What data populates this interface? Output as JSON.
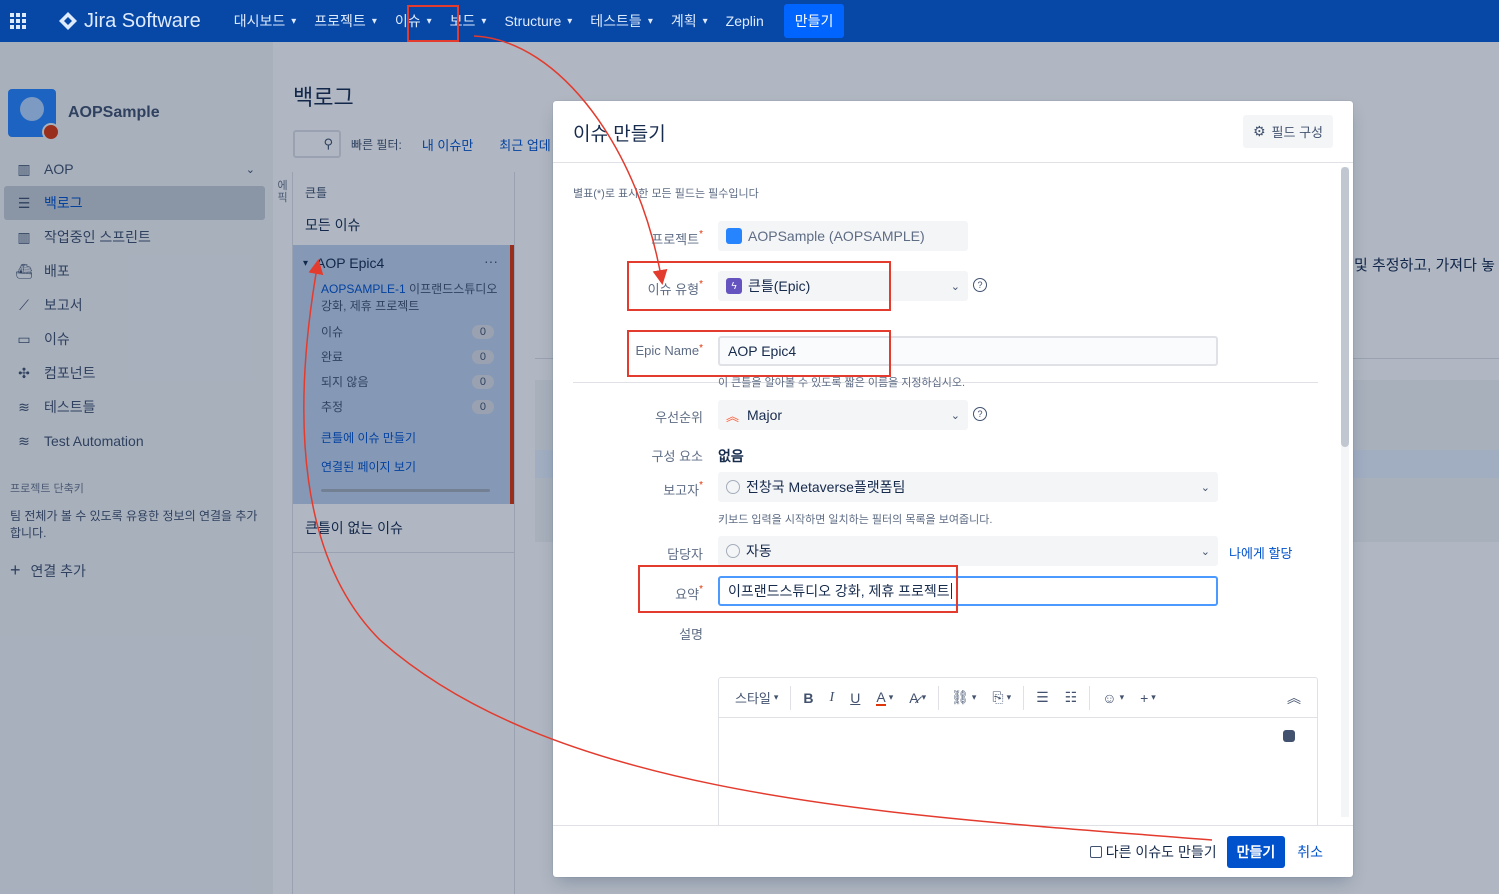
{
  "nav": {
    "product": "Jira Software",
    "items": [
      {
        "label": "대시보드",
        "chev": true
      },
      {
        "label": "프로젝트",
        "chev": true
      },
      {
        "label": "이슈",
        "chev": true
      },
      {
        "label": "보드",
        "chev": true
      },
      {
        "label": "Structure",
        "chev": true
      },
      {
        "label": "테스트들",
        "chev": true
      },
      {
        "label": "계획",
        "chev": true
      },
      {
        "label": "Zeplin",
        "chev": false
      }
    ],
    "create": "만들기"
  },
  "sidebar": {
    "project_name": "AOPSample",
    "items": [
      {
        "label": "AOP",
        "icon": "board-icon"
      },
      {
        "label": "백로그",
        "icon": "backlog-icon"
      },
      {
        "label": "작업중인 스프린트",
        "icon": "sprint-icon"
      },
      {
        "label": "배포",
        "icon": "ship-icon"
      },
      {
        "label": "보고서",
        "icon": "chart-icon"
      },
      {
        "label": "이슈",
        "icon": "issues-icon"
      },
      {
        "label": "컴포넌트",
        "icon": "puzzle-icon"
      },
      {
        "label": "테스트들",
        "icon": "tests-icon"
      },
      {
        "label": "Test Automation",
        "icon": "automation-icon"
      }
    ],
    "shortcuts_heading": "프로젝트 단축키",
    "shortcuts_text": "팀 전체가 볼 수 있도록 유용한 정보의 연결을 추가합니다.",
    "add_link": "연결 추가"
  },
  "backlog": {
    "title": "백로그",
    "quick_filters_label": "빠른 필터:",
    "filter_mine": "내 이슈만",
    "filter_recent": "최근 업데",
    "epic_tab": "에픽",
    "epic_heading": "큰틀",
    "all_issues": "모든 이슈",
    "epic": {
      "name": "AOP Epic4",
      "menu": "···",
      "key": "AOPSAMPLE-1",
      "summary": "이프랜드스튜디오 강화, 제휴 프로젝트",
      "stats": [
        {
          "label": "이슈",
          "count": "0"
        },
        {
          "label": "완료",
          "count": "0"
        },
        {
          "label": "되지 않음",
          "count": "0"
        },
        {
          "label": "추정",
          "count": "0"
        }
      ],
      "create_issue": "큰틀에 이슈 만들기",
      "linked_pages": "연결된 페이지 보기"
    },
    "no_epic": "큰틀이 없는 이슈",
    "right_text": "및 추정하고, 가져다 놓"
  },
  "modal": {
    "title": "이슈 만들기",
    "configure_fields": "필드 구성",
    "required_note": "별표(*)로 표시한 모든 필드는 필수입니다",
    "project_label": "프로젝트",
    "project_value": "AOPSample (AOPSAMPLE)",
    "issue_type_label": "이슈 유형",
    "issue_type_value": "큰틀(Epic)",
    "epic_name_label": "Epic Name",
    "epic_name_value": "AOP Epic4",
    "epic_name_hint": "이 큰틀을 알아볼 수 있도록 짧은 이름을 지정하십시오.",
    "priority_label": "우선순위",
    "priority_value": "Major",
    "component_label": "구성 요소",
    "component_value": "없음",
    "reporter_label": "보고자",
    "reporter_value": "전창국 Metaverse플랫폼팀",
    "reporter_hint": "키보드 입력을 시작하면 일치하는 필터의 목록을 보여줍니다.",
    "assignee_label": "담당자",
    "assignee_value": "자동",
    "assign_to_me": "나에게 할당",
    "summary_label": "요약",
    "summary_value": "이프랜드스튜디오 강화, 제휴 프로젝트",
    "description_label": "설명",
    "toolbar_style": "스타일",
    "create_another": "다른 이슈도 만들기",
    "submit": "만들기",
    "cancel": "취소"
  },
  "colors": {
    "nav_bg": "#0747a6",
    "accent": "#0052cc",
    "annotation_red": "#e33b2e",
    "epic_purple": "#6554c0",
    "priority_orange": "#ff5630"
  }
}
